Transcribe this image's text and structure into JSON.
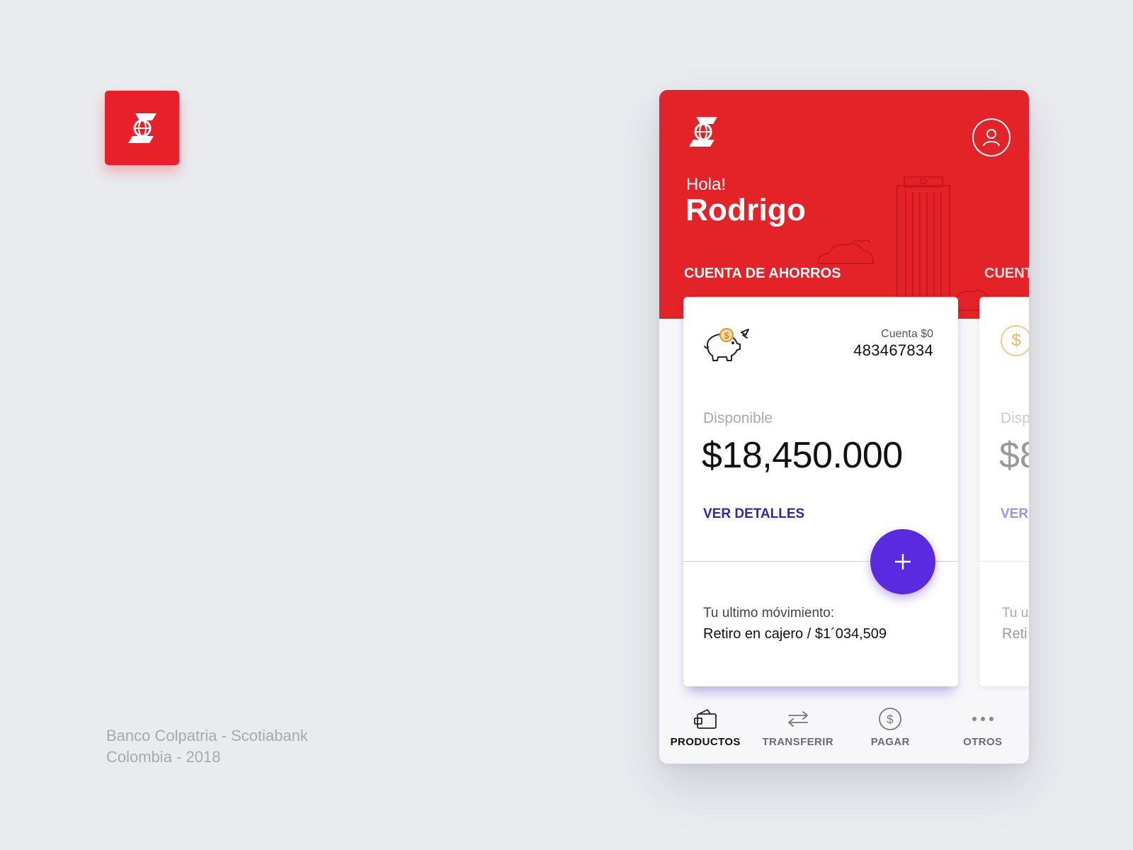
{
  "brand": {
    "primary_color": "#e42328",
    "accent_color": "#5a2ae0",
    "link_color": "#2b2a9e",
    "logo_icon": "scotiabank-logo-icon"
  },
  "credits": {
    "line1": "Banco Colpatria - Scotiabank",
    "line2": "Colombia - 2018"
  },
  "header": {
    "greeting": "Hola!",
    "user_name": "Rodrigo",
    "profile_icon": "user-profile-icon"
  },
  "products": [
    {
      "type": "CUENTA DE AHORROS",
      "icon": "piggy-bank-icon",
      "account_label": "Cuenta $0",
      "account_number": "483467834",
      "available_label": "Disponible",
      "balance": "$18,450.000",
      "details_label": "VER DETALLES",
      "last_move_label": "Tu ultimo móvimiento:",
      "last_move_value": "Retiro en cajero / $1´034,509"
    },
    {
      "type": "CUENT",
      "icon": "dollar-coin-icon",
      "available_label": "Disp",
      "balance": "$8",
      "details_label": "VER",
      "last_move_label": "Tu u",
      "last_move_value": "Reti"
    }
  ],
  "fab": {
    "icon": "plus-icon"
  },
  "nav": {
    "items": [
      {
        "label": "PRODUCTOS",
        "icon": "wallet-icon",
        "active": true
      },
      {
        "label": "TRANSFERIR",
        "icon": "transfer-arrows-icon",
        "active": false
      },
      {
        "label": "PAGAR",
        "icon": "dollar-circle-icon",
        "active": false
      },
      {
        "label": "OTROS",
        "icon": "more-dots-icon",
        "active": false
      }
    ]
  }
}
